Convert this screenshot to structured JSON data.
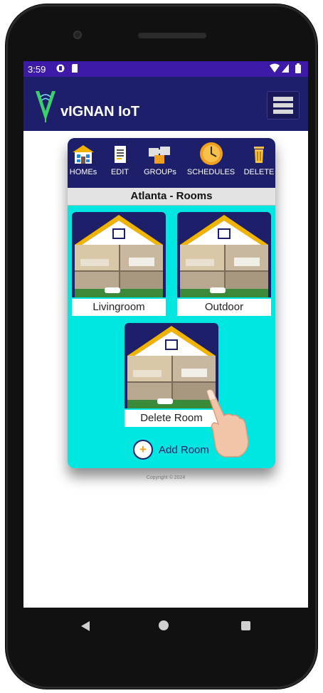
{
  "status": {
    "time": "3:59"
  },
  "app": {
    "title": "vIGNAN IoT"
  },
  "toolbar": {
    "homes": "HOMEs",
    "edit": "EDIT",
    "groups": "GROUPs",
    "schedules": "SCHEDULES",
    "delete": "DELETE"
  },
  "rooms_header": "Atlanta - Rooms",
  "rooms": [
    {
      "label": "Livingroom"
    },
    {
      "label": "Outdoor"
    },
    {
      "label": "Delete Room"
    }
  ],
  "add_room": {
    "icon": "+",
    "label": "Add Room"
  },
  "footer": {
    "copyright": "Copyright © 2024"
  },
  "colors": {
    "statusbar": "#3d1aa8",
    "appbar": "#1e1f6b",
    "card": "#00e6e0",
    "roof": "#f0b400"
  }
}
